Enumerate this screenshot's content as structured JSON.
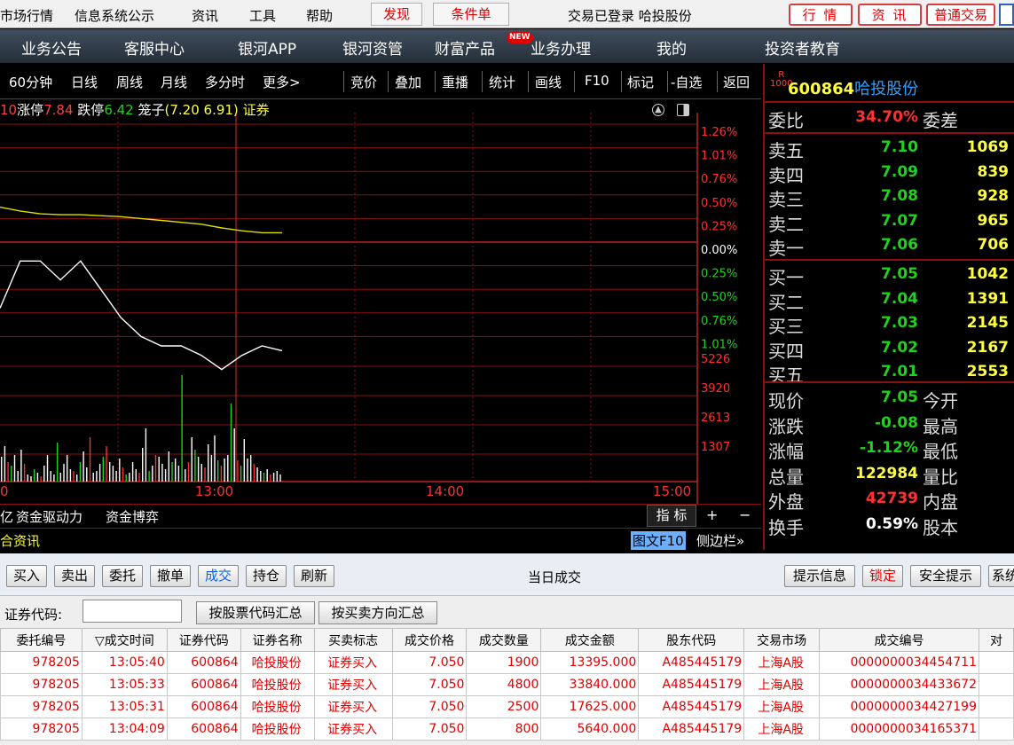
{
  "menubar": {
    "items": [
      "市场行情",
      "信息系统公示",
      "资讯",
      "工具",
      "帮助"
    ],
    "discover": "发现",
    "conditional_order": "条件单",
    "status": "交易已登录 哈投股份",
    "right_buttons": [
      "行 情",
      "资 讯",
      "普通交易"
    ]
  },
  "navbar": {
    "items": [
      "业务公告",
      "客服中心",
      "银河APP",
      "银河资管",
      "财富产品",
      "业务办理",
      "我的",
      "投资者教育"
    ],
    "new_badge": "NEW"
  },
  "toolbar": {
    "items": [
      "60分钟",
      "日线",
      "周线",
      "月线",
      "多分时",
      "更多>",
      "竞价",
      "叠加",
      "重播",
      "统计",
      "画线",
      "F10",
      "标记",
      "-自选",
      "返回"
    ]
  },
  "chart_info": {
    "prefix": "10",
    "limit_up_label": "涨停",
    "limit_up": "7.84",
    "limit_down_label": "跌停",
    "limit_down": "6.42",
    "cage_label": "笼子",
    "cage": "(7.20 6.91)",
    "sector": "证券"
  },
  "chart_data": {
    "type": "line",
    "x_tick_labels": [
      "0",
      "13:00",
      "14:00",
      "15:00"
    ],
    "right_axis_pct": [
      "1.26%",
      "1.01%",
      "0.76%",
      "0.50%",
      "0.25%",
      "0.00%",
      "0.25%",
      "0.50%",
      "0.76%",
      "1.01%"
    ],
    "volume_axis": [
      "5226",
      "3920",
      "2613",
      "1307"
    ],
    "series": [
      {
        "values": [
          0.37,
          0.33,
          0.3,
          0.29,
          0.29,
          0.28,
          0.27,
          0.25,
          0.23,
          0.21,
          0.19,
          0.15,
          0.12,
          0.1,
          0.1
        ]
      },
      {
        "values": [
          -0.7,
          -0.2,
          -0.2,
          -0.4,
          -0.2,
          -0.5,
          -0.8,
          -1.0,
          -1.1,
          -1.1,
          -1.2,
          -1.35,
          -1.2,
          -1.1,
          -1.15
        ]
      }
    ],
    "volume_heights": [
      28,
      40,
      22,
      18,
      30,
      12,
      36,
      20,
      8,
      6,
      14,
      10,
      6,
      18,
      30,
      12,
      8,
      44,
      10,
      20,
      30,
      14,
      12,
      8,
      22,
      34,
      16,
      50,
      10,
      12,
      20,
      28,
      40,
      22,
      18,
      12,
      26,
      16,
      8,
      10,
      22,
      14,
      10,
      38,
      60,
      12,
      18,
      30,
      28,
      20,
      14,
      34,
      22,
      26,
      18,
      120,
      14,
      22,
      50,
      36,
      28,
      20,
      16,
      42,
      30,
      52,
      24,
      18,
      26,
      30,
      88,
      60,
      24,
      18,
      48,
      26,
      30,
      20,
      16,
      12,
      10,
      14,
      8,
      10,
      12,
      8
    ],
    "grid": true
  },
  "bottom_tabs": {
    "left_fragment": "亿",
    "tab1": "资金驱动力",
    "tab2": "资金博弈",
    "index_label": "指 标",
    "plus": "+",
    "minus": "−",
    "news": "合资讯",
    "graphic_f10": "图文F10",
    "sidebar": "侧边栏»"
  },
  "quote": {
    "badge": "R",
    "code": "600864",
    "name": "哈投股份",
    "weibi_label": "委比",
    "weibi_value": "34.70%",
    "weicha_label": "委差",
    "sells": [
      {
        "label": "卖五",
        "price": "7.10",
        "volume": "1069"
      },
      {
        "label": "卖四",
        "price": "7.09",
        "volume": "839"
      },
      {
        "label": "卖三",
        "price": "7.08",
        "volume": "928"
      },
      {
        "label": "卖二",
        "price": "7.07",
        "volume": "965"
      },
      {
        "label": "卖一",
        "price": "7.06",
        "volume": "706"
      }
    ],
    "buys": [
      {
        "label": "买一",
        "price": "7.05",
        "volume": "1042"
      },
      {
        "label": "买二",
        "price": "7.04",
        "volume": "1391"
      },
      {
        "label": "买三",
        "price": "7.03",
        "volume": "2145"
      },
      {
        "label": "买四",
        "price": "7.02",
        "volume": "2167"
      },
      {
        "label": "买五",
        "price": "7.01",
        "volume": "2553"
      }
    ],
    "stats": [
      {
        "label": "现价",
        "value": "7.05",
        "label2": "今开",
        "color": "#1ed31e"
      },
      {
        "label": "涨跌",
        "value": "-0.08",
        "label2": "最高",
        "color": "#1ed31e"
      },
      {
        "label": "涨幅",
        "value": "-1.12%",
        "label2": "最低",
        "color": "#1ed31e"
      },
      {
        "label": "总量",
        "value": "122984",
        "label2": "量比",
        "color": "#ffff40"
      },
      {
        "label": "外盘",
        "value": "42739",
        "label2": "内盘",
        "color": "#ff3030"
      },
      {
        "label": "换手",
        "value": "0.59%",
        "label2": "股本",
        "color": "#ffffff"
      }
    ]
  },
  "trade": {
    "buttons": [
      "买入",
      "卖出",
      "委托",
      "撤单",
      "成交",
      "持仓",
      "刷新"
    ],
    "active_button": "成交",
    "title": "当日成交",
    "right_buttons": [
      "提示信息",
      "锁定",
      "安全提示",
      "系统"
    ],
    "code_label": "证券代码:",
    "code_value": "",
    "sum_by_code": "按股票代码汇总",
    "sum_by_direction": "按买卖方向汇总",
    "columns": [
      "委托编号",
      "▽成交时间",
      "证券代码",
      "证券名称",
      "买卖标志",
      "成交价格",
      "成交数量",
      "成交金额",
      "股东代码",
      "交易市场",
      "成交编号",
      "对"
    ],
    "rows": [
      [
        "978205",
        "13:05:40",
        "600864",
        "哈投股份",
        "证券买入",
        "7.050",
        "1900",
        "13395.000",
        "A485445179",
        "上海A股",
        "0000000034454711",
        ""
      ],
      [
        "978205",
        "13:05:33",
        "600864",
        "哈投股份",
        "证券买入",
        "7.050",
        "4800",
        "33840.000",
        "A485445179",
        "上海A股",
        "0000000034433672",
        ""
      ],
      [
        "978205",
        "13:05:31",
        "600864",
        "哈投股份",
        "证券买入",
        "7.050",
        "2500",
        "17625.000",
        "A485445179",
        "上海A股",
        "0000000034427199",
        ""
      ],
      [
        "978205",
        "13:04:09",
        "600864",
        "哈投股份",
        "证券买入",
        "7.050",
        "800",
        "5640.000",
        "A485445179",
        "上海A股",
        "0000000034165371",
        ""
      ]
    ]
  }
}
